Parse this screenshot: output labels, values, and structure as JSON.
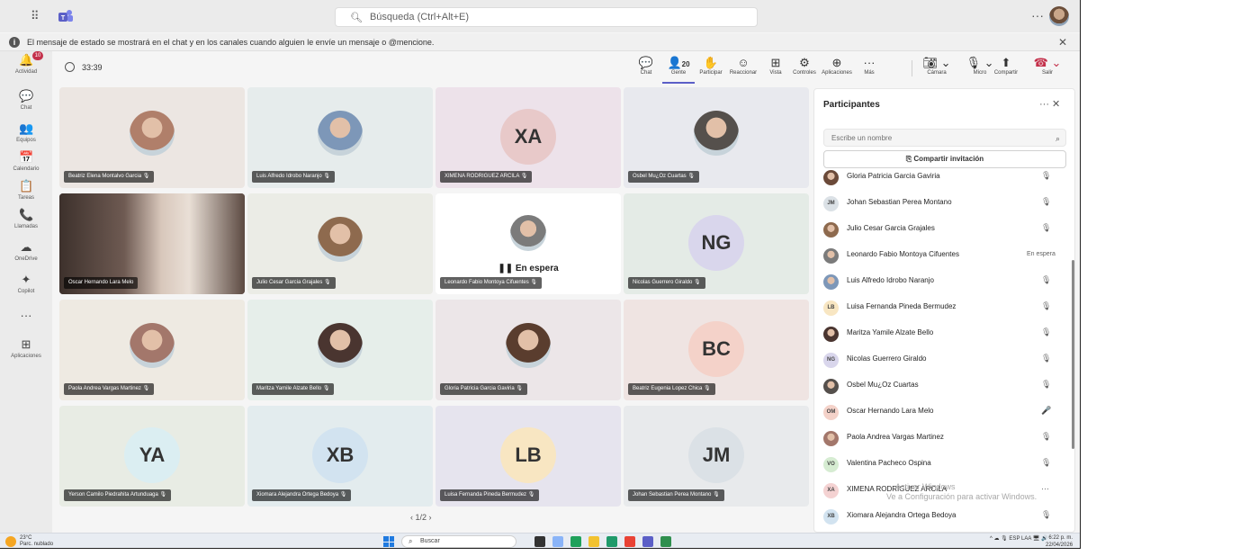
{
  "topbar": {
    "search_placeholder": "Búsqueda (Ctrl+Alt+E)",
    "more": "···"
  },
  "banner": {
    "text": "El mensaje de estado se mostrará en el chat y en los canales cuando alguien le envíe un mensaje o @mencione."
  },
  "rail": [
    {
      "label": "Actividad",
      "icon": "bell-icon",
      "glyph": "🔔",
      "badge": "10"
    },
    {
      "label": "Chat",
      "icon": "chat-icon",
      "glyph": "💬"
    },
    {
      "label": "Equipos",
      "icon": "teams-icon",
      "glyph": "👥"
    },
    {
      "label": "Calendario",
      "icon": "calendar-icon",
      "glyph": "📅"
    },
    {
      "label": "Tareas",
      "icon": "tasks-icon",
      "glyph": "📋"
    },
    {
      "label": "Llamadas",
      "icon": "phone-icon",
      "glyph": "📞"
    },
    {
      "label": "OneDrive",
      "icon": "cloud-icon",
      "glyph": "☁"
    },
    {
      "label": "Copilot",
      "icon": "copilot-icon",
      "glyph": "✦"
    },
    {
      "label": "",
      "icon": "more-icon",
      "glyph": "···"
    },
    {
      "label": "Aplicaciones",
      "icon": "apps-icon",
      "glyph": "⊞"
    }
  ],
  "meeting": {
    "timer": "33:39",
    "participant_count": "20",
    "toolbar": [
      {
        "label": "Chat",
        "icon": "chat-icon",
        "glyph": "💬"
      },
      {
        "label": "Gente",
        "icon": "people-icon",
        "glyph": "👤"
      },
      {
        "label": "Participar",
        "icon": "raise-hand-icon",
        "glyph": "✋"
      },
      {
        "label": "Reaccionar",
        "icon": "emoji-icon",
        "glyph": "☺"
      },
      {
        "label": "Vista",
        "icon": "grid-icon",
        "glyph": "⊞"
      },
      {
        "label": "Controles",
        "icon": "controls-icon",
        "glyph": "⚙"
      },
      {
        "label": "Aplicaciones",
        "icon": "add-app-icon",
        "glyph": "⊕"
      },
      {
        "label": "Más",
        "icon": "more-icon",
        "glyph": "···"
      }
    ],
    "camera_label": "Cámara",
    "mic_label": "Micro",
    "share_label": "Compartir",
    "leave_label": "Salir"
  },
  "tiles": [
    {
      "name": "Beatriz Elena Montalvo Garcia",
      "type": "photo",
      "bg": "#ece6e2",
      "av": "#b07f6a"
    },
    {
      "name": "Luis Alfredo Idrobo Naranjo",
      "type": "photo",
      "bg": "#e6ecec",
      "av": "#7d97b8"
    },
    {
      "name": "XIMENA RODRIGUEZ ARCILA",
      "type": "initials",
      "initials": "XA",
      "bg": "#ede2ea",
      "av": "#e8c9c9"
    },
    {
      "name": "Osbel Mu¿Oz Cuartas",
      "type": "photo",
      "bg": "#e8e9ee",
      "av": "#55504c"
    },
    {
      "name": "Oscar Hernando Lara Melo",
      "type": "video",
      "bg": "#5a4a44",
      "av": "#c5a58f"
    },
    {
      "name": "Julio Cesar Garcia Grajales",
      "type": "photo",
      "bg": "#ebece6",
      "av": "#8e6a4e"
    },
    {
      "name": "Leonardo Fabio Montoya Cifuentes",
      "type": "onhold",
      "bg": "#ffffff",
      "av": "#7b7b7b",
      "status": "En espera"
    },
    {
      "name": "Nicolas Guerrero Giraldo",
      "type": "initials",
      "initials": "NG",
      "bg": "#e4ebe6",
      "av": "#d9d6ec"
    },
    {
      "name": "Paola Andrea Vargas Martinez",
      "type": "photo",
      "bg": "#eeeae2",
      "av": "#a3776b"
    },
    {
      "name": "Maritza Yamile Alzate Bello",
      "type": "photo",
      "bg": "#e6eeea",
      "av": "#4a3530"
    },
    {
      "name": "Gloria Patricia Garcia Gaviria",
      "type": "photo",
      "bg": "#ece6e8",
      "av": "#5a3d2e"
    },
    {
      "name": "Beatriz Eugenia Lopez Chica",
      "type": "initials",
      "initials": "BC",
      "bg": "#efe4e2",
      "av": "#f4d2c9"
    },
    {
      "name": "Yerson Camilo Piedrahita Artunduaga",
      "type": "initials",
      "initials": "YA",
      "bg": "#e8ece4",
      "av": "#dbeef2"
    },
    {
      "name": "Xiomara Alejandra Ortega Bedoya",
      "type": "initials",
      "initials": "XB",
      "bg": "#e3ecee",
      "av": "#d2e3f0"
    },
    {
      "name": "Luisa Fernanda Pineda Bermudez",
      "type": "initials",
      "initials": "LB",
      "bg": "#e6e4ee",
      "av": "#f8e6c2"
    },
    {
      "name": "Johan Sebastian Perea Montano",
      "type": "initials",
      "initials": "JM",
      "bg": "#e8eaec",
      "av": "#dbe1e6"
    }
  ],
  "pager": "‹  1/2  ›",
  "panel": {
    "title": "Participantes",
    "controls": "···   ✕",
    "search_placeholder": "Escribe un nombre",
    "invite": "Compartir invitación",
    "people": [
      {
        "name": "Gloria Patricia Garcia Gaviria",
        "initials": "",
        "av": "#6b4a39",
        "status": "🎙"
      },
      {
        "name": "Johan Sebastian Perea Montano",
        "initials": "JM",
        "av": "#dbe1e6",
        "status": "🎙"
      },
      {
        "name": "Julio Cesar Garcia Grajales",
        "initials": "",
        "av": "#8e6a4e",
        "status": "🎙"
      },
      {
        "name": "Leonardo Fabio Montoya Cifuentes",
        "initials": "",
        "av": "#7b7b7b",
        "status": "En espera"
      },
      {
        "name": "Luis Alfredo Idrobo Naranjo",
        "initials": "",
        "av": "#7d97b8",
        "status": "🎙"
      },
      {
        "name": "Luisa Fernanda Pineda Bermudez",
        "initials": "LB",
        "av": "#f8e6c2",
        "status": "🎙"
      },
      {
        "name": "Maritza Yamile Alzate Bello",
        "initials": "",
        "av": "#4a3530",
        "status": "🎙"
      },
      {
        "name": "Nicolas Guerrero Giraldo",
        "initials": "NG",
        "av": "#d9d6ec",
        "status": "🎙"
      },
      {
        "name": "Osbel Mu¿Oz Cuartas",
        "initials": "",
        "av": "#55504c",
        "status": "🎙"
      },
      {
        "name": "Oscar Hernando Lara Melo",
        "initials": "OM",
        "av": "#f4d2c9",
        "status": "🎤"
      },
      {
        "name": "Paola Andrea Vargas Martinez",
        "initials": "",
        "av": "#a3776b",
        "status": "🎙"
      },
      {
        "name": "Valentina Pacheco Ospina",
        "initials": "VO",
        "av": "#d6ecd2",
        "status": "🎙"
      },
      {
        "name": "XIMENA RODRIGUEZ ARCILA",
        "initials": "XA",
        "av": "#f4d2d2",
        "status": "···"
      },
      {
        "name": "Xiomara Alejandra Ortega Bedoya",
        "initials": "XB",
        "av": "#d2e3f0",
        "status": "🎙"
      }
    ],
    "watermark_line1": "Activar Windows",
    "watermark_line2": "Ve a Configuración para activar Windows."
  },
  "taskbar": {
    "temp": "23°C",
    "weather": "Parc. nublado",
    "search": "Buscar",
    "tray": "^   ☁   🎙   ESP LAA   🖥 🔊",
    "time": "6:22 p. m.",
    "date": "22/04/2026"
  }
}
